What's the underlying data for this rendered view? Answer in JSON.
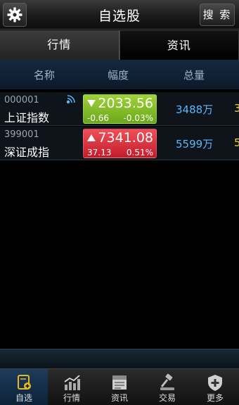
{
  "header": {
    "title": "自选股",
    "search_label": "搜 索"
  },
  "tabs": [
    {
      "label": "行情",
      "active": true
    },
    {
      "label": "资讯",
      "active": false
    }
  ],
  "columns": [
    "名称",
    "幅度",
    "总量"
  ],
  "rows": [
    {
      "code": "000001",
      "name": "上证指数",
      "price": "2033.56",
      "change": "-0.66",
      "percent": "-0.03%",
      "volume": "3488万",
      "extra": "3",
      "direction": "down",
      "color": "#7ab82a"
    },
    {
      "code": "399001",
      "name": "深证成指",
      "price": "7341.08",
      "change": "37.13",
      "percent": "0.51%",
      "volume": "5599万",
      "extra": "5",
      "direction": "up",
      "color": "#d92b38"
    }
  ],
  "nav": [
    {
      "label": "自选",
      "icon": "watchlist-icon",
      "active": true
    },
    {
      "label": "行情",
      "icon": "chart-icon",
      "active": false
    },
    {
      "label": "资讯",
      "icon": "news-icon",
      "active": false
    },
    {
      "label": "交易",
      "icon": "gavel-icon",
      "active": false
    },
    {
      "label": "更多",
      "icon": "shield-plus-icon",
      "active": false
    }
  ],
  "colors": {
    "accent_blue": "#59b6ff",
    "up_red": "#d92b38",
    "down_green": "#7ab82a"
  }
}
